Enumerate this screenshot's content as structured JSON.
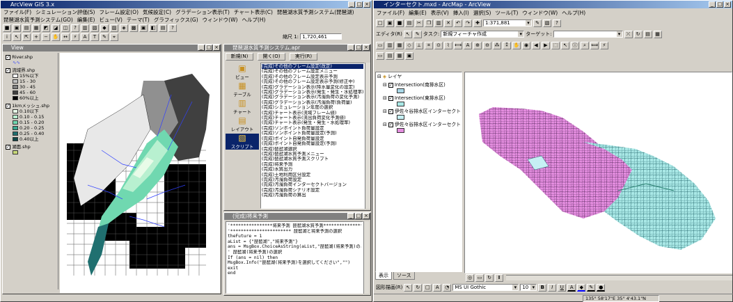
{
  "left_app": {
    "title": "ArcView GIS 3.x",
    "menu": [
      "ファイル(F)",
      "シミュレーション評価(S)",
      "フレーム設定(O)",
      "気候設定(C)",
      "グラデーション表示(T)",
      "チャート表示(C)",
      "琵琶湖水質予測システム(琵琶湖)"
    ],
    "menu2": [
      "琵琶湖水質予測システム(GO)",
      "編集(E)",
      "ビュー(V)",
      "テーマ(T)",
      "グラフィックス(G)",
      "ウィンドウ(W)",
      "ヘルプ(H)"
    ],
    "scale_label": "縮尺 1:",
    "scale_value": "1,720,461",
    "view_title": "View",
    "legend": [
      {
        "label": "River.shp",
        "items": []
      },
      {
        "label": "流域界.shp",
        "items": [
          "15%以下",
          "15 - 30",
          "30 - 45",
          "45 - 60",
          "60%以上"
        ]
      },
      {
        "label": "1kmメッシュ.shp",
        "items": [
          "0.10以下",
          "0.10 - 0.15",
          "0.15 - 0.20",
          "0.20 - 0.25",
          "0.25 - 0.40",
          "0.40以上"
        ]
      },
      {
        "label": "湖面.shp",
        "items": []
      }
    ],
    "project_title": "琵琶湖水質予測システム.apr",
    "project_buttons": [
      "新規(N)",
      "開く(O)",
      "実行(R)"
    ],
    "project_icons": [
      "ビュー",
      "テーブル",
      "チャート",
      "レイアウト",
      "スクリプト"
    ],
    "scripts": [
      "(完成)その他のフレーム設定(改定)",
      "(完成)その他のフレーム設定メニュー",
      "(完成)その他のフレーム設定表示予測",
      "(完成)その他のフレーム設定表示予測(修正中)",
      "(完成)グラデーション表示(降水量変化の設定)",
      "(完成)グラデーション表示(発生・発生・水処理率)",
      "(完成)グラデーション表示(汚濁負荷の変化予測)",
      "(完成)グラデーション表示(汚濁負荷(負荷量)",
      "(完成)シミュレーション年度の選択",
      "(完成)チャート表示(流域フレーム値)",
      "(完成)チャート表示(流出負荷変化予測値)",
      "(完成)チャート表示(発生・発生・水処理率)",
      "(完成)ソンポイント負荷量設定",
      "(完成)ソンポイント負荷量設定(予測)",
      "(完成)ポイント自発負荷量設定",
      "(完成)ポイント自発負荷量設定(予測)",
      "(完成)琵琶湖選択",
      "(完成)琵琶湖水質予測メニュー",
      "(完成)琵琶湖水質予測スクリプト",
      "(完成)将来予測",
      "(完成)水質出力",
      "(完成)土地利用区分設定",
      "(完成)汚濁負荷設定",
      "(完成)汚濁負荷インターセクトバージョン",
      "(完成)汚濁負荷シナリオ設定",
      "(完成)汚濁負荷の算出"
    ],
    "script_editor_title": "(完成)将来予測",
    "script_lines": [
      "'****************将来予測 琵琶湖水質予測*****************",
      "",
      "'*********************** 琵琶湖と将来予測の選択",
      "theFuture = 1",
      "",
      "aList = {\"琵琶湖\",\"将来予測\"}",
      "ans = MsgBox.ChoiceAsString(aList,\"琵琶湖(将来予測)のどちら",
      "' 琵琶湖(将来予測)の選択",
      "",
      "If (ans = nil) then",
      "  MsgBox.Info(\"琵琶湖(将来予測)を選択してください\",\"\")",
      "  exit",
      "end"
    ]
  },
  "right_app": {
    "title": "インターセクト.mxd - ArcMap - ArcView",
    "menu": [
      "ファイル(F)",
      "編集(E)",
      "表示(V)",
      "挿入(I)",
      "選択(S)",
      "ツール(T)",
      "ウィンドウ(W)",
      "ヘルプ(H)"
    ],
    "scale_value": "1:371,881",
    "editor_label": "エディタ(R)",
    "task_label": "タスク:",
    "task_value": "新規フィーチャ作成",
    "target_label": "ターゲット:",
    "toc_root": "レイヤ",
    "layers": [
      {
        "name": "Intersection(南排水区)",
        "color": "#a9d8e8"
      },
      {
        "name": "Intersection(東排水区)",
        "color": "#a9e8e6"
      },
      {
        "name": "伊佐々谷排水区インターセクト",
        "color": "#c6f0f4"
      },
      {
        "name": "伊佐々谷排水区インターセクト",
        "color": "#e58ee0"
      }
    ],
    "tabs": [
      "表示",
      "ソース"
    ],
    "drawing_label": "図形描画(R)",
    "font_name": "MS UI Gothic",
    "font_size": "10",
    "bold": "B",
    "italic": "I",
    "underline": "U",
    "status_coords": "135° 58'17\"E  35° 4'43.1\"N"
  }
}
